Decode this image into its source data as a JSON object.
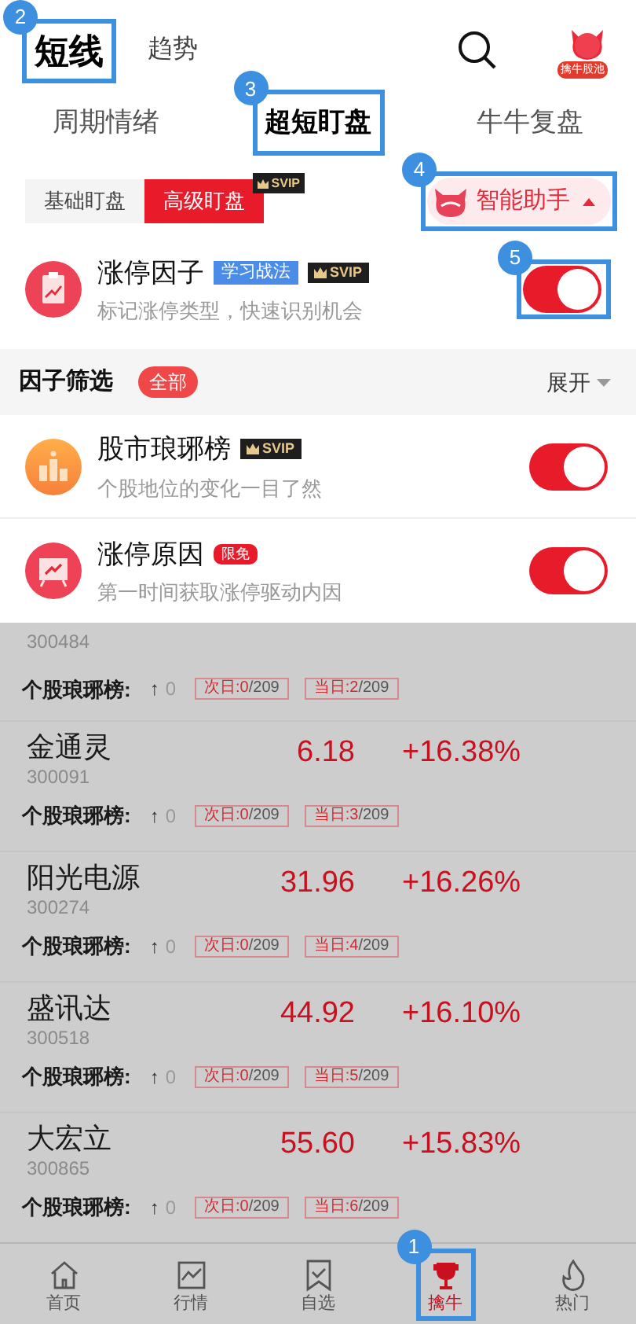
{
  "header": {
    "tabs": [
      {
        "label": "短线",
        "selected": true,
        "callout": "2"
      },
      {
        "label": "趋势",
        "selected": false
      }
    ],
    "avatar_badge": "擒牛股池"
  },
  "subtabs": [
    {
      "label": "周期情绪",
      "selected": false
    },
    {
      "label": "超短盯盘",
      "selected": true,
      "callout": "3"
    },
    {
      "label": "牛牛复盘",
      "selected": false
    }
  ],
  "modes": [
    {
      "label": "基础盯盘",
      "selected": false
    },
    {
      "label": "高级盯盘",
      "selected": true,
      "badge": "SVIP"
    }
  ],
  "assistant": {
    "label": "智能助手",
    "expanded": true,
    "callout": "4"
  },
  "main_factor": {
    "kind": "limit",
    "title": "涨停因子",
    "tags": [
      {
        "kind": "learn",
        "text": "学习战法"
      },
      {
        "kind": "svip",
        "text": "SVIP"
      }
    ],
    "subtitle": "标记涨停类型，快速识别机会",
    "on": true,
    "callout": "5"
  },
  "filter": {
    "title": "因子筛选",
    "chip": "全部",
    "expand": "展开"
  },
  "factors": [
    {
      "kind": "rank",
      "title": "股市琅琊榜",
      "tags": [
        {
          "kind": "svip",
          "text": "SVIP"
        }
      ],
      "subtitle": "个股地位的变化一目了然",
      "on": true
    },
    {
      "kind": "reason",
      "title": "涨停原因",
      "tags": [
        {
          "kind": "free",
          "text": "限免"
        }
      ],
      "subtitle": "第一时间获取涨停驱动内因",
      "on": true
    }
  ],
  "stocks": [
    {
      "code": "300484",
      "rank_label": "个股琅琊榜:",
      "arrow": "↑",
      "rank_change": "0",
      "days": [
        {
          "label": "次日:",
          "count": "0",
          "total": "/209"
        },
        {
          "label": "当日:",
          "count": "2",
          "total": "/209"
        }
      ]
    },
    {
      "name": "金通灵",
      "code": "300091",
      "price": "6.18",
      "change": "+16.38%",
      "rank_label": "个股琅琊榜:",
      "arrow": "↑",
      "rank_change": "0",
      "days": [
        {
          "label": "次日:",
          "count": "0",
          "total": "/209"
        },
        {
          "label": "当日:",
          "count": "3",
          "total": "/209"
        }
      ]
    },
    {
      "name": "阳光电源",
      "code": "300274",
      "price": "31.96",
      "change": "+16.26%",
      "rank_label": "个股琅琊榜:",
      "arrow": "↑",
      "rank_change": "0",
      "days": [
        {
          "label": "次日:",
          "count": "0",
          "total": "/209"
        },
        {
          "label": "当日:",
          "count": "4",
          "total": "/209"
        }
      ]
    },
    {
      "name": "盛讯达",
      "code": "300518",
      "price": "44.92",
      "change": "+16.10%",
      "rank_label": "个股琅琊榜:",
      "arrow": "↑",
      "rank_change": "0",
      "days": [
        {
          "label": "次日:",
          "count": "0",
          "total": "/209"
        },
        {
          "label": "当日:",
          "count": "5",
          "total": "/209"
        }
      ]
    },
    {
      "name": "大宏立",
      "code": "300865",
      "price": "55.60",
      "change": "+15.83%",
      "rank_label": "个股琅琊榜:",
      "arrow": "↑",
      "rank_change": "0",
      "days": [
        {
          "label": "次日:",
          "count": "0",
          "total": "/209"
        },
        {
          "label": "当日:",
          "count": "6",
          "total": "/209"
        }
      ]
    }
  ],
  "nav": [
    {
      "kind": "home",
      "label": "首页",
      "selected": false
    },
    {
      "kind": "chart",
      "label": "行情",
      "selected": false
    },
    {
      "kind": "watch",
      "label": "自选",
      "selected": false
    },
    {
      "kind": "trophy",
      "label": "擒牛",
      "selected": true,
      "callout": "1"
    },
    {
      "kind": "fire",
      "label": "热门",
      "selected": false
    }
  ]
}
